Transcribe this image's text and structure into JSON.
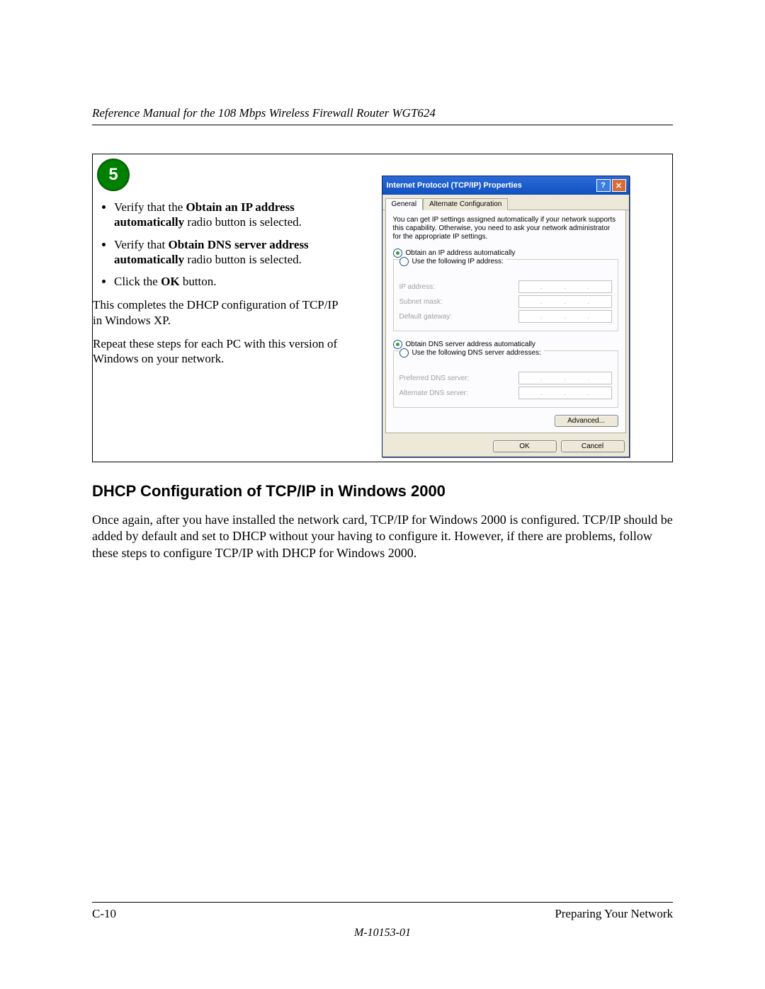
{
  "header": {
    "manual_title": "Reference Manual for the 108 Mbps Wireless Firewall Router WGT624"
  },
  "step": {
    "number": "5",
    "bullets": {
      "b1_pre": "Verify that the ",
      "b1_bold": "Obtain an IP address automatically",
      "b1_post": " radio button is selected.",
      "b2_pre": "Verify that ",
      "b2_bold": "Obtain DNS server address automatically",
      "b2_post": " radio button is selected.",
      "b3_pre": "Click the ",
      "b3_bold": "OK",
      "b3_post": " button."
    },
    "para1": "This completes the DHCP configuration of TCP/IP in Windows XP.",
    "para2": "Repeat these steps for each PC with this version of Windows on your network."
  },
  "dialog": {
    "title": "Internet Protocol (TCP/IP) Properties",
    "tabs": {
      "general": "General",
      "alt": "Alternate Configuration"
    },
    "desc": "You can get IP settings assigned automatically if your network supports this capability. Otherwise, you need to ask your network administrator for the appropriate IP settings.",
    "ip_auto": "Obtain an IP address automatically",
    "ip_manual": "Use the following IP address:",
    "ip_address": "IP address:",
    "subnet": "Subnet mask:",
    "gateway": "Default gateway:",
    "dns_auto": "Obtain DNS server address automatically",
    "dns_manual": "Use the following DNS server addresses:",
    "pref_dns": "Preferred DNS server:",
    "alt_dns": "Alternate DNS server:",
    "advanced": "Advanced...",
    "ok": "OK",
    "cancel": "Cancel"
  },
  "section": {
    "heading": "DHCP Configuration of TCP/IP in Windows 2000",
    "body": "Once again, after you have installed the network card, TCP/IP for Windows 2000 is configured. TCP/IP should be added by default and set to DHCP without your having to configure it. However, if there are problems, follow these steps to configure TCP/IP with DHCP for Windows 2000."
  },
  "footer": {
    "page": "C-10",
    "section": "Preparing Your Network",
    "code": "M-10153-01"
  }
}
